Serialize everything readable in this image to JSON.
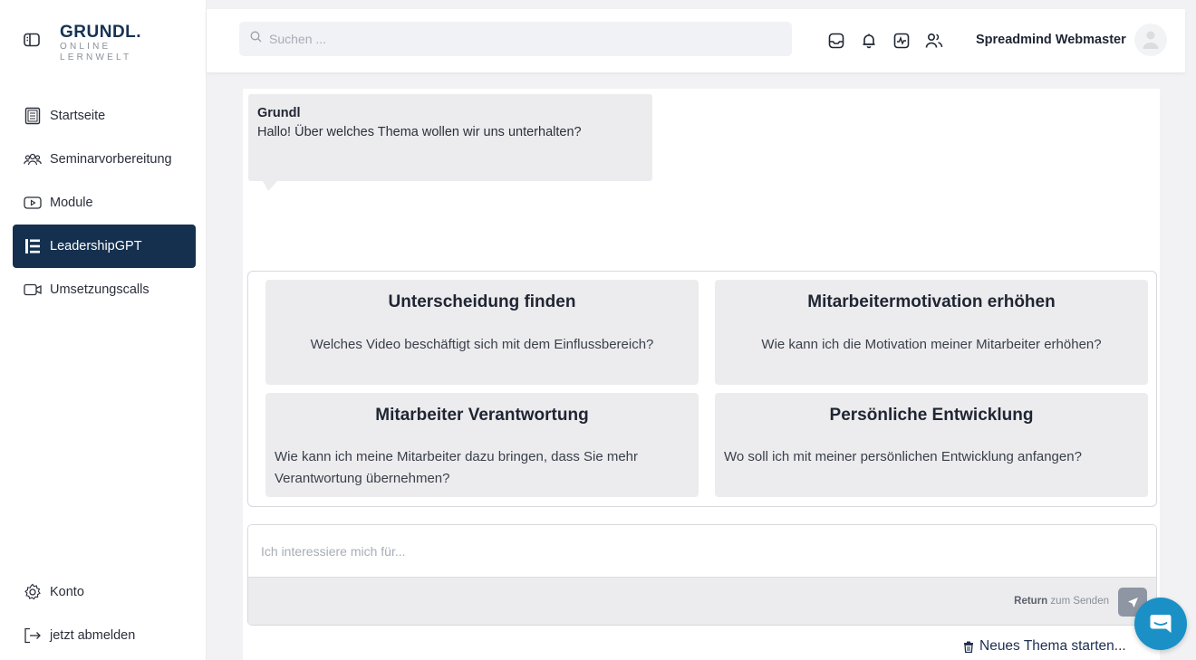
{
  "logo": {
    "main": "GRUNDL.",
    "sub1": "ONLINE",
    "sub2": "LERNWELT"
  },
  "sidebar": {
    "items": [
      {
        "label": "Startseite",
        "icon": "home-book-icon"
      },
      {
        "label": "Seminarvorbereitung",
        "icon": "users-icon"
      },
      {
        "label": "Module",
        "icon": "play-icon"
      },
      {
        "label": "LeadershipGPT",
        "icon": "list-icon",
        "active": true
      },
      {
        "label": "Umsetzungscalls",
        "icon": "video-camera-icon"
      }
    ],
    "bottom": [
      {
        "label": "Konto",
        "icon": "gear-icon"
      },
      {
        "label": "jetzt abmelden",
        "icon": "logout-icon"
      }
    ]
  },
  "topbar": {
    "search_placeholder": "Suchen ...",
    "icons": [
      "inbox-icon",
      "bell-icon",
      "activity-icon",
      "users-icon"
    ],
    "username": "Spreadmind Webmaster"
  },
  "chat": {
    "bot_name": "Grundl",
    "bot_message": "Hallo! Über welches Thema wollen wir uns unterhalten?"
  },
  "suggestions": [
    {
      "title": "Unterscheidung finden",
      "text": "Welches Video beschäftigt sich mit dem Einflussbereich?"
    },
    {
      "title": "Mitarbeitermotivation erhöhen",
      "text": "Wie kann ich die Motivation meiner Mitarbeiter erhöhen?"
    },
    {
      "title": "Mitarbeiter Verantwortung",
      "text": "Wie kann ich meine Mitarbeiter dazu bringen, dass Sie mehr Verantwortung übernehmen?"
    },
    {
      "title": "Persönliche Entwicklung",
      "text": "Wo soll ich mit meiner persönlichen Entwicklung anfangen?"
    }
  ],
  "composer": {
    "placeholder": "Ich interessiere mich für...",
    "hint_key": "Return",
    "hint_text": "zum Senden"
  },
  "new_topic_label": "Neues Thema starten...",
  "colors": {
    "primary": "#15304f",
    "fab": "#1a90c6",
    "card_bg": "#ececee"
  }
}
